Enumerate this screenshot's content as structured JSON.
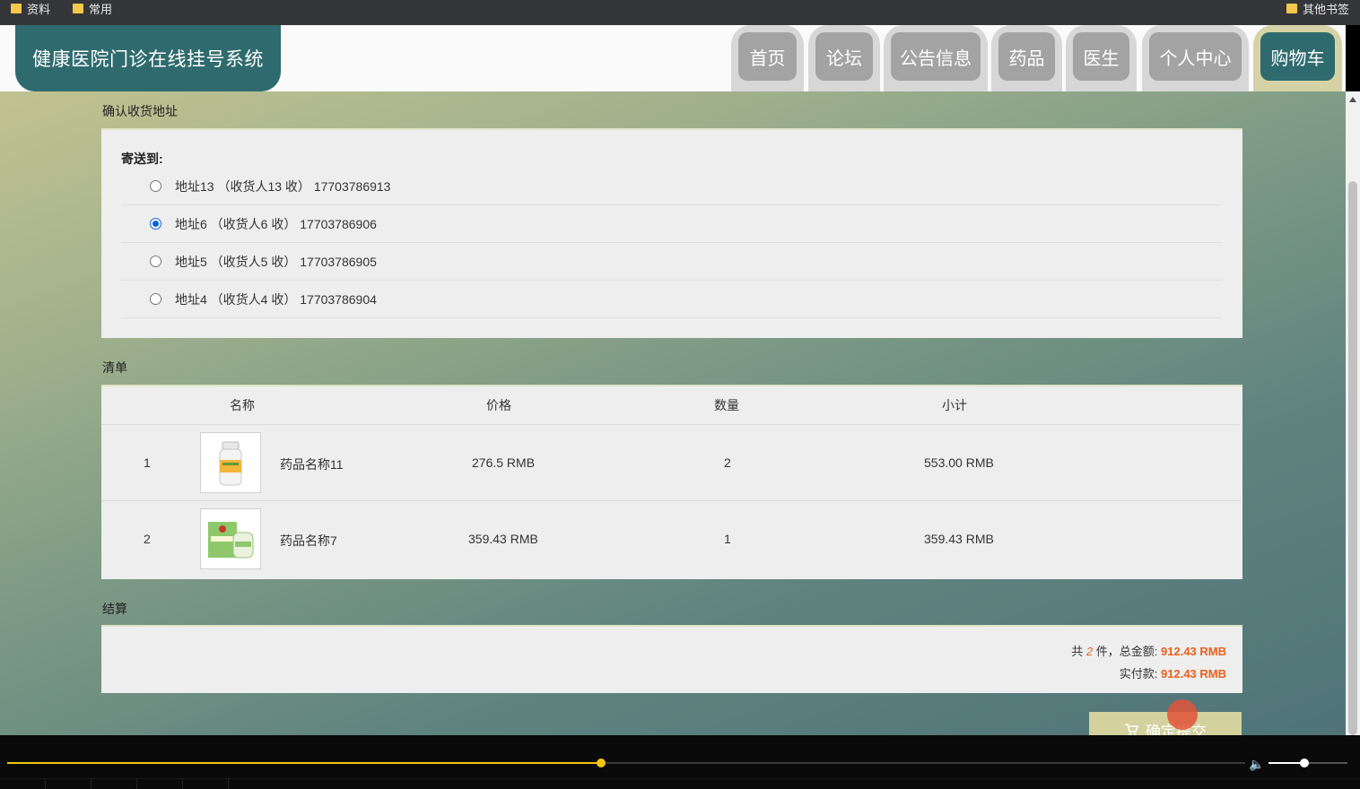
{
  "bookmarks": {
    "left": [
      {
        "label": "资料",
        "icon": "folder-icon"
      },
      {
        "label": "常用",
        "icon": "folder-icon"
      }
    ],
    "right": {
      "label": "其他书签",
      "icon": "folder-icon"
    }
  },
  "header": {
    "site_title": "健康医院门诊在线挂号系统",
    "nav": [
      {
        "label": "首页",
        "active": false
      },
      {
        "label": "论坛",
        "active": false
      },
      {
        "label": "公告信息",
        "active": false
      },
      {
        "label": "药品",
        "active": false
      },
      {
        "label": "医生",
        "active": false
      },
      {
        "label": "个人中心",
        "active": false
      },
      {
        "label": "购物车",
        "active": true
      }
    ]
  },
  "address": {
    "section_title": "确认收货地址",
    "send_to_label": "寄送到:",
    "options": [
      {
        "text": "地址13 （收货人13 收）  17703786913",
        "checked": false
      },
      {
        "text": "地址6 （收货人6 收）  17703786906",
        "checked": true
      },
      {
        "text": "地址5 （收货人5 收）  17703786905",
        "checked": false
      },
      {
        "text": "地址4 （收货人4 收）  17703786904",
        "checked": false
      }
    ]
  },
  "list": {
    "section_title": "清单",
    "headers": {
      "name": "名称",
      "price": "价格",
      "qty": "数量",
      "subtotal": "小计"
    },
    "rows": [
      {
        "index": "1",
        "name": "药品名称11",
        "price": "276.5 RMB",
        "qty": "2",
        "subtotal": "553.00 RMB"
      },
      {
        "index": "2",
        "name": "药品名称7",
        "price": "359.43 RMB",
        "qty": "1",
        "subtotal": "359.43 RMB"
      }
    ]
  },
  "checkout": {
    "section_title": "结算",
    "line1_prefix": "共",
    "count": "2",
    "line1_mid": "件，总金额:",
    "total": "912.43 RMB",
    "line2_prefix": "实付款:",
    "paid": "912.43 RMB",
    "submit_label": "确定提交"
  },
  "player": {
    "progress": 0.48,
    "volume": 0.45
  },
  "colors": {
    "accent": "#2f6b6e",
    "price": "#e8601c",
    "progress": "#f2c511"
  }
}
